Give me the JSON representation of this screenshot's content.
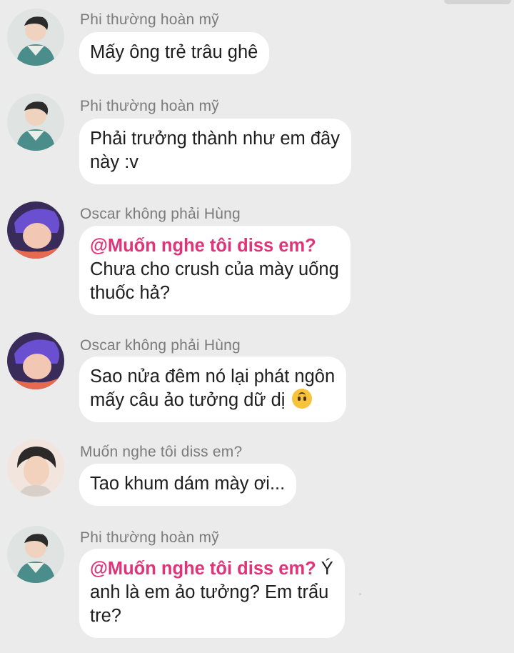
{
  "colors": {
    "background": "#ebebeb",
    "bubble": "#ffffff",
    "sender": "#7b7b7b",
    "mention": "#e0347a",
    "text": "#1e1e1e"
  },
  "messages": [
    {
      "sender": "Phi thường hoàn mỹ",
      "avatar": "avatar-phi",
      "mention": "",
      "lines": [
        "Mấy ông trẻ trâu ghê"
      ]
    },
    {
      "sender": "Phi thường hoàn mỹ",
      "avatar": "avatar-phi",
      "mention": "",
      "lines": [
        "Phải trưởng thành như em đây",
        "này :v"
      ]
    },
    {
      "sender": "Oscar không phải Hùng",
      "avatar": "avatar-oscar",
      "mention": "@Muốn nghe tôi diss em?",
      "lines": [
        "Chưa cho crush của mày uống",
        "thuốc hả?"
      ]
    },
    {
      "sender": "Oscar không phải Hùng",
      "avatar": "avatar-oscar",
      "mention": "",
      "lines": [
        "Sao nửa đêm nó lại phát ngôn",
        "mấy câu ảo tưởng dữ dị"
      ],
      "emoji": "upside-down-face"
    },
    {
      "sender": "Muốn nghe tôi diss em?",
      "avatar": "avatar-muon",
      "mention": "",
      "lines": [
        "Tao khum dám mày ơi..."
      ]
    },
    {
      "sender": "Phi thường hoàn mỹ",
      "avatar": "avatar-phi",
      "mention": "@Muốn nghe tôi diss em?",
      "mention_suffix": " Ý",
      "lines": [
        "anh là em ảo tưởng? Em trẩu",
        "tre?"
      ]
    }
  ]
}
